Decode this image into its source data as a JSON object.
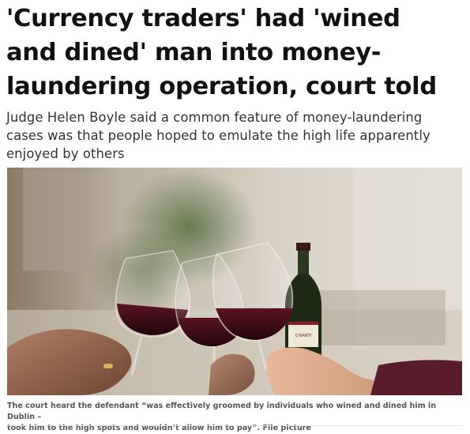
{
  "article": {
    "headline_lines": [
      "'Currency traders' had 'wined",
      "and dined' man into money-",
      "laundering operation, court told"
    ],
    "standfirst_lines": [
      "Judge Helen Boyle said a common feature of money-laundering",
      "cases was that people hoped to emulate the high life apparently",
      "enjoyed by others"
    ],
    "image": {
      "subject": "wine glasses toast",
      "bottle_label_text": "CHIANTI"
    },
    "caption_lines": [
      "The court heard the defendant “was effectively groomed by individuals who wined and dined him in Dublin –",
      "took him to the high spots and wouldn’t allow him to pay”. File picture"
    ]
  },
  "colors": {
    "headline": "#111111",
    "standfirst": "#333333",
    "caption": "#555555",
    "wine": "#3a0a14"
  }
}
